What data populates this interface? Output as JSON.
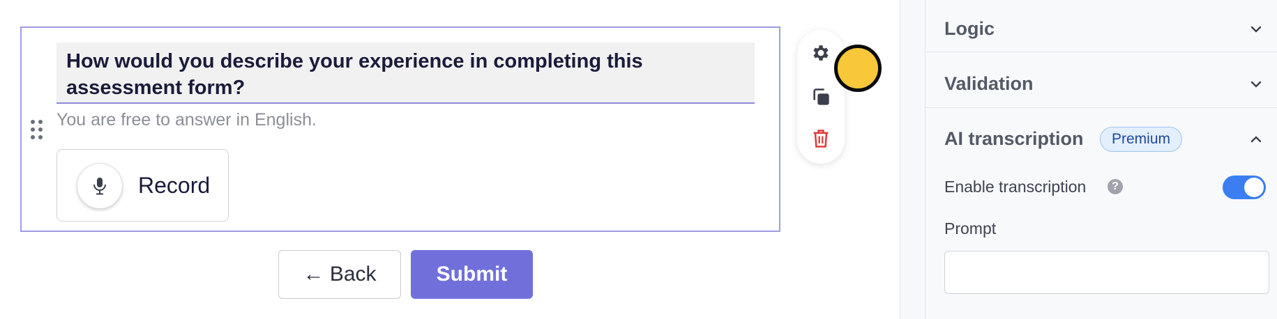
{
  "question": {
    "title": "How would you describe your experience in completing this assessment form?",
    "help_text": "You are free to answer in English.",
    "record_label": "Record"
  },
  "question_actions": {
    "icons": [
      "gear-icon",
      "duplicate-icon",
      "trash-icon"
    ]
  },
  "form_buttons": {
    "back_label": "← Back",
    "submit_label": "Submit"
  },
  "side_panel": {
    "sections": {
      "logic": "Logic",
      "validation": "Validation",
      "ai_transcription": "AI transcription"
    },
    "premium_badge": "Premium",
    "enable_transcription_label": "Enable transcription",
    "enable_transcription_on": true,
    "help_icon_glyph": "?",
    "prompt_label": "Prompt",
    "prompt_value": ""
  },
  "colors": {
    "accent": "#7170db",
    "toggle_on": "#3a7ef2",
    "danger": "#e03b3b",
    "cursor": "#f8c83a"
  }
}
